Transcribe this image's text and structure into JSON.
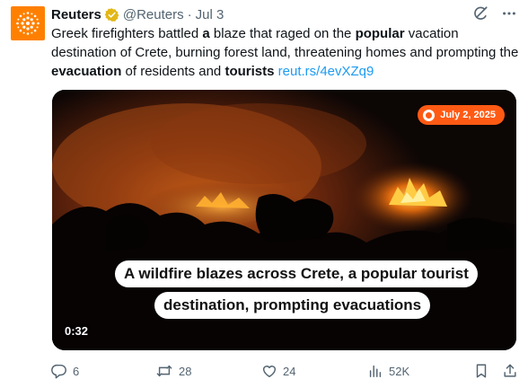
{
  "tweet": {
    "author_name": "Reuters",
    "author_handle": "@Reuters",
    "separator": "·",
    "date": "Jul 3",
    "text_segments": [
      {
        "text": "Greek firefighters battled ",
        "bold": false
      },
      {
        "text": "a",
        "bold": true
      },
      {
        "text": " blaze that raged on the ",
        "bold": false
      },
      {
        "text": "popular",
        "bold": true
      },
      {
        "text": " vacation destination of Crete, burning forest land, threatening homes and prompting the ",
        "bold": false
      },
      {
        "text": "evacuation",
        "bold": true
      },
      {
        "text": " of residents and ",
        "bold": false
      },
      {
        "text": "tourists",
        "bold": true
      },
      {
        "text": " ",
        "bold": false
      }
    ],
    "link_text": "reut.rs/4evXZq9"
  },
  "media": {
    "date_badge": "July 2, 2025",
    "caption_line1": "A wildfire blazes across Crete, a popular tourist",
    "caption_line2": "destination, prompting evacuations",
    "duration": "0:32"
  },
  "actions": {
    "replies": "6",
    "reposts": "28",
    "likes": "24",
    "views": "52K"
  },
  "colors": {
    "brand_orange": "#ff8000",
    "verified_gold": "#e2b719",
    "link_blue": "#1d9bf0",
    "muted_gray": "#536471",
    "badge_orange": "#ff5a14"
  },
  "icons": [
    "reuters-logo-icon",
    "verified-badge-icon",
    "grok-icon",
    "more-icon",
    "reply-icon",
    "repost-icon",
    "like-icon",
    "views-icon",
    "bookmark-icon",
    "share-icon"
  ]
}
